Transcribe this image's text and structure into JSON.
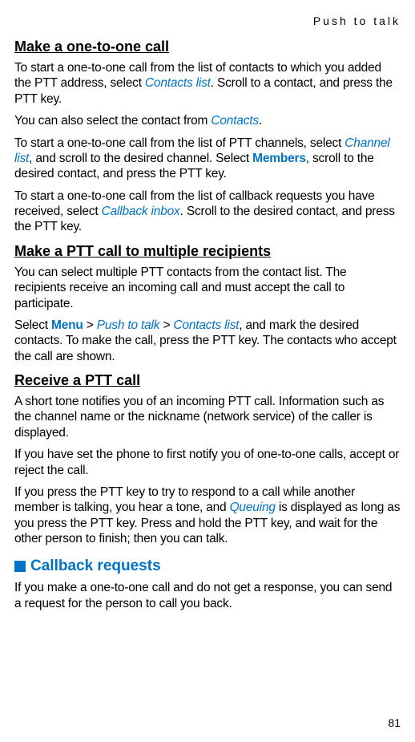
{
  "header": "Push to talk",
  "section1": {
    "title": "Make a one-to-one call",
    "p1_a": "To start a one-to-one call from the list of contacts to which you added the PTT address, select ",
    "p1_link1": "Contacts list",
    "p1_b": ". Scroll to a contact, and press the PTT key.",
    "p2_a": "You can also select the contact from ",
    "p2_link1": "Contacts",
    "p2_b": ".",
    "p3_a": "To start a one-to-one call from the list of PTT channels, select ",
    "p3_link1": "Channel list",
    "p3_b": ", and scroll to the desired channel. Select ",
    "p3_link2": "Members",
    "p3_c": ", scroll to the desired contact, and press the PTT key.",
    "p4_a": "To start a one-to-one call from the list of callback requests you have received, select ",
    "p4_link1": "Callback inbox",
    "p4_b": ". Scroll to the desired contact, and press the PTT key."
  },
  "section2": {
    "title": "Make a PTT call to multiple recipients",
    "p1": "You can select multiple PTT contacts from the contact list. The recipients receive an incoming call and must accept the call to participate.",
    "p2_a": "Select ",
    "p2_link1": "Menu",
    "p2_gt1": " > ",
    "p2_link2": "Push to talk",
    "p2_gt2": " > ",
    "p2_link3": "Contacts list",
    "p2_b": ", and mark the desired contacts. To make the call, press the PTT key. The contacts who accept the call are shown."
  },
  "section3": {
    "title": "Receive a PTT call",
    "p1": "A short tone notifies you of an incoming PTT call. Information such as the channel name or the nickname (network service) of the caller is displayed.",
    "p2": "If you have set the phone to first notify you of one-to-one calls, accept or reject the call.",
    "p3_a": "If you press the PTT key to try to respond to a call while another member is talking, you hear a tone, and ",
    "p3_link1": "Queuing",
    "p3_b": " is displayed as long as you press the PTT key. Press and hold the PTT key, and wait for the other person to finish; then you can talk."
  },
  "section4": {
    "title": "Callback requests",
    "p1": "If you make a one-to-one call and do not get a response, you can send a request for the person to call you back."
  },
  "pageNumber": "81"
}
